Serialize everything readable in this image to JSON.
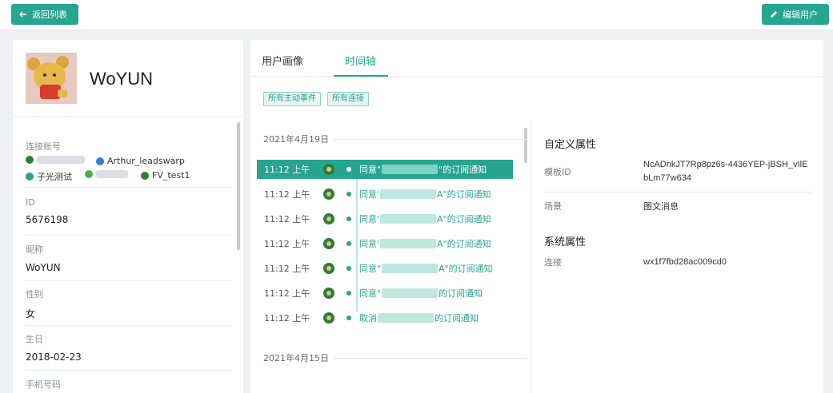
{
  "header": {
    "back_label": "返回列表",
    "edit_label": "编辑用户"
  },
  "profile": {
    "name": "WoYUN"
  },
  "fields": {
    "accounts_label": "连接账号",
    "accounts": [
      {
        "name": "",
        "color": "#2f7d34"
      },
      {
        "name": "Arthur_leadswarp",
        "color": "#3a7bd5"
      },
      {
        "name": "子光测试",
        "color": "#26a590"
      },
      {
        "name": "",
        "color": "#4cae4c"
      },
      {
        "name": "FV_test1",
        "color": "#2f7d34"
      }
    ],
    "id_label": "ID",
    "id_value": "5676198",
    "nickname_label": "昵称",
    "nickname_value": "WoYUN",
    "gender_label": "性别",
    "gender_value": "女",
    "birthday_label": "生日",
    "birthday_value": "2018-02-23",
    "phone_label": "手机号码"
  },
  "tabs": [
    {
      "label": "用户画像",
      "active": false
    },
    {
      "label": "时间轴",
      "active": true
    }
  ],
  "filters": [
    "所有主动事件",
    "所有连接"
  ],
  "timeline": {
    "groups": [
      {
        "date": "2021年4月19日",
        "events": [
          {
            "time": "11:12 上午",
            "prefix": "同意\"",
            "suffix": "\"的订阅通知",
            "selected": true
          },
          {
            "time": "11:12 上午",
            "prefix": "同意'",
            "suffix": "A\"的订阅通知",
            "selected": false
          },
          {
            "time": "11:12 上午",
            "prefix": "同意'",
            "suffix": "A\"的订阅通知",
            "selected": false
          },
          {
            "time": "11:12 上午",
            "prefix": "同意'",
            "suffix": "A\"的订阅通知",
            "selected": false
          },
          {
            "time": "11:12 上午",
            "prefix": "同意\"",
            "suffix": "A\"的订阅通知",
            "selected": false
          },
          {
            "time": "11:12 上午",
            "prefix": "同意\"",
            "suffix": "的订阅通知",
            "selected": false
          },
          {
            "time": "11:12 上午",
            "prefix": "取消",
            "suffix": "的订阅通知",
            "selected": false
          }
        ]
      },
      {
        "date": "2021年4月15日",
        "events": []
      }
    ]
  },
  "properties": {
    "custom_title": "自定义属性",
    "template_label": "模板ID",
    "template_value": "NcADnkJT7Rp8pz6s-4436YEP-jBSH_vIlEbLm77w634",
    "scene_label": "场景",
    "scene_value": "图文消息",
    "system_title": "系统属性",
    "connection_label": "连接",
    "connection_value": "wx1f7fbd28ac009cd0"
  },
  "colors": {
    "accent": "#26a590"
  }
}
